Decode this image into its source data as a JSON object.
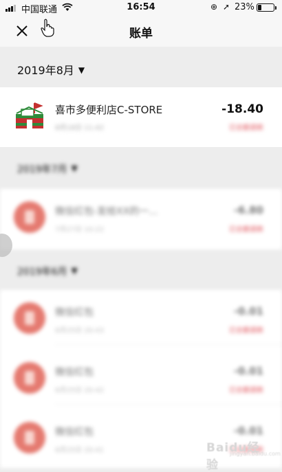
{
  "status_bar": {
    "carrier": "中国联通",
    "time": "16:54",
    "battery": "23%",
    "battery_level": 0.23,
    "icons": [
      "signal-icon",
      "wifi-icon",
      "rotation-lock-icon",
      "location-icon",
      "battery-icon"
    ]
  },
  "nav": {
    "title": "账单",
    "close_icon": "close-icon",
    "cursor_icon": "hand-pointer-icon"
  },
  "months": [
    {
      "label": "2019年8月",
      "transactions": [
        {
          "merchant": "喜市多便利店C-STORE",
          "amount": "-18.40",
          "time": "8月18日 11:42",
          "status": "已全额退款",
          "icon": "store-logo-icon"
        }
      ]
    },
    {
      "label": "2019年7月",
      "transactions": [
        {
          "merchant": "微信红包-发给XX的一...",
          "amount": "-6.80",
          "time": "7月27日 10:22",
          "status": "已全额退款",
          "icon": "red-packet-icon"
        }
      ]
    },
    {
      "label": "2019年6月",
      "transactions": [
        {
          "merchant": "微信红包",
          "amount": "-0.01",
          "time": "6月25日 20:43",
          "status": "已全额退款",
          "icon": "red-packet-icon"
        },
        {
          "merchant": "微信红包",
          "amount": "-0.01",
          "time": "6月25日 20:42",
          "status": "已全额退款",
          "icon": "red-packet-icon"
        },
        {
          "merchant": "微信红包",
          "amount": "-0.01",
          "time": "6月25日 20:41",
          "status": "已全额退款",
          "icon": "red-packet-icon"
        }
      ]
    }
  ],
  "watermark": {
    "text": "Baidu经验",
    "sub": "jingyan.baidu.com"
  },
  "colors": {
    "background": "#ededed",
    "card": "#ffffff",
    "red_packet": "#e57a70",
    "refund_text": "#e0525a"
  }
}
